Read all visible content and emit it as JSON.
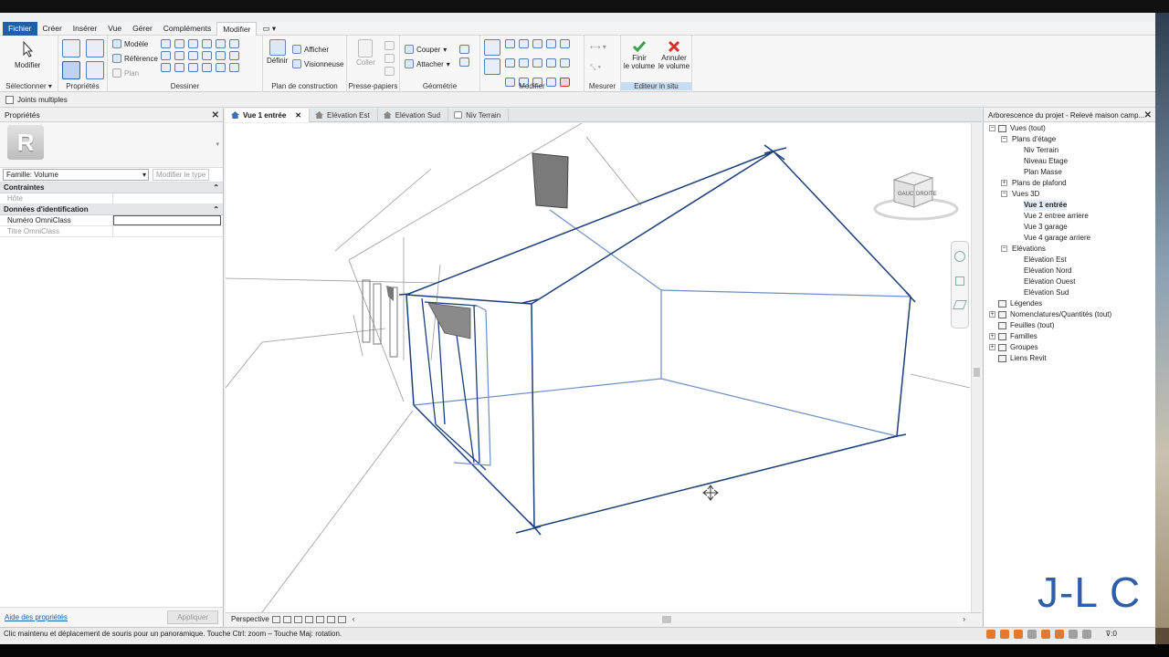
{
  "menu": {
    "items": [
      "Fichier",
      "Créer",
      "Insérer",
      "Vue",
      "Gérer",
      "Compléments",
      "Modifier"
    ],
    "active": "Modifier"
  },
  "ribbon": {
    "modifier_label": "Modifier",
    "select_label": "Sélectionner ▾",
    "proprietes_label": "Propriétés",
    "modele": "Modèle",
    "reference": "Référence",
    "plan": "Plan",
    "dessiner_label": "Dessiner",
    "definir": "Définir",
    "afficher": "Afficher",
    "visionneuse": "Visionneuse",
    "plan_construction_label": "Plan de construction",
    "coller": "Coller",
    "presse_papiers_label": "Presse-papiers",
    "couper": "Couper",
    "attacher": "Attacher",
    "geometrie_label": "Géométrie",
    "modifier_panel_label": "Modifier",
    "mesurer_label": "Mesurer",
    "finir_volume": [
      "Finir",
      "le volume"
    ],
    "annuler_volume": [
      "Annuler",
      "le volume"
    ],
    "editeur_label": "Editeur in situ"
  },
  "options": {
    "joints_multiples": "Joints multiples"
  },
  "properties": {
    "title": "Propriétés",
    "logo_letter": "R",
    "family": "Famille: Volume",
    "edit_type": "Modifier le type",
    "sections": [
      {
        "name": "Contraintes",
        "rows": [
          {
            "key": "Hôte",
            "value": "",
            "disabled": true
          }
        ]
      },
      {
        "name": "Données d'identification",
        "rows": [
          {
            "key": "Numéro OmniClass",
            "value": "",
            "disabled": false
          },
          {
            "key": "Titre OmniClass",
            "value": "",
            "disabled": true
          }
        ]
      }
    ],
    "help_link": "Aide des propriétés",
    "apply": "Appliquer"
  },
  "view_tabs": [
    {
      "label": "Vue 1 entrée",
      "active": true
    },
    {
      "label": "Elévation Est",
      "active": false
    },
    {
      "label": "Elévation Sud",
      "active": false
    },
    {
      "label": "Niv Terrain",
      "active": false
    }
  ],
  "navcube": {
    "face_top": "GAUC",
    "face_right": "DROITE"
  },
  "view_control": {
    "mode": "Perspective"
  },
  "browser": {
    "title": "Arborescence du projet - Relevé maison camp...",
    "nodes": [
      {
        "label": "Vues (tout)",
        "level": 0,
        "toggle": "−",
        "icon": true
      },
      {
        "label": "Plans d'étage",
        "level": 1,
        "toggle": "−"
      },
      {
        "label": "Niv Terrain",
        "level": 2
      },
      {
        "label": "Niveau Etage",
        "level": 2
      },
      {
        "label": "Plan Masse",
        "level": 2
      },
      {
        "label": "Plans de plafond",
        "level": 1,
        "toggle": "+"
      },
      {
        "label": "Vues 3D",
        "level": 1,
        "toggle": "−"
      },
      {
        "label": "Vue 1 entrée",
        "level": 2,
        "bold": true
      },
      {
        "label": "Vue 2 entree arriere",
        "level": 2
      },
      {
        "label": "Vue 3 garage",
        "level": 2
      },
      {
        "label": "Vue 4 garage arriere",
        "level": 2
      },
      {
        "label": "Elévations",
        "level": 1,
        "toggle": "−"
      },
      {
        "label": "Elévation Est",
        "level": 2
      },
      {
        "label": "Elévation Nord",
        "level": 2
      },
      {
        "label": "Elévation Ouest",
        "level": 2
      },
      {
        "label": "Elévation Sud",
        "level": 2
      },
      {
        "label": "Légendes",
        "level": 0,
        "icon": true
      },
      {
        "label": "Nomenclatures/Quantités (tout)",
        "level": 0,
        "toggle": "+",
        "icon": true
      },
      {
        "label": "Feuilles (tout)",
        "level": 0,
        "icon": true
      },
      {
        "label": "Familles",
        "level": 0,
        "toggle": "+",
        "icon": true
      },
      {
        "label": "Groupes",
        "level": 0,
        "toggle": "+",
        "icon": true
      },
      {
        "label": "Liens Revit",
        "level": 0,
        "icon": true
      }
    ]
  },
  "status": {
    "text": "Clic maintenu et déplacement de souris pour un panoramique. Touche Ctrl: zoom – Touche Maj: rotation.",
    "right_value": ":0"
  },
  "watermark": "J-L C",
  "colors": {
    "file_tab": "#1f5fa8",
    "model_line": "#1c3f7a",
    "watermark": "#2f5ea8",
    "finish": "#3aa24a",
    "cancel": "#d9302c"
  }
}
